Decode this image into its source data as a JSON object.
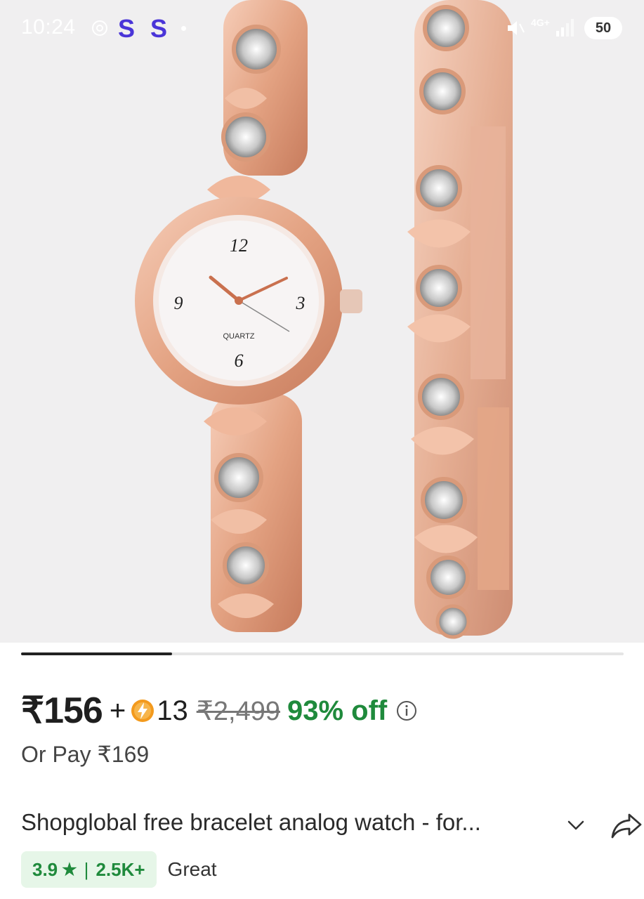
{
  "status_bar": {
    "time": "10:24",
    "app_indicator": "S S",
    "network": "4G+",
    "battery": "50",
    "icons": [
      "chrome-icon",
      "mute-icon",
      "signal-icon"
    ]
  },
  "gallery": {
    "image_alt": "Rose gold bracelet watch with heart bracelet",
    "watch_dial": {
      "brand_text": "QUARTZ",
      "n12": "12",
      "n3": "3",
      "n6": "6",
      "n9": "9"
    },
    "progress": 0.25
  },
  "pricing": {
    "price": "₹156",
    "plus": "+",
    "coin_icon": "bolt-coin-icon",
    "coins": "13",
    "mrp": "₹2,499",
    "discount": "93% off",
    "alt_price": "Or Pay ₹169"
  },
  "product": {
    "title": "Shopglobal free bracelet analog watch  - for...",
    "expand_icon": "chevron-down-icon",
    "share_icon": "share-icon"
  },
  "rating": {
    "score": "3.9",
    "star": "★",
    "separator": "|",
    "count": "2.5K+",
    "label": "Great"
  },
  "colors": {
    "accent_green": "#1f8a3c",
    "rating_bg": "#e6f6e8",
    "status_ss": "#4a35d8",
    "rose_gold": "#e8a98a"
  }
}
